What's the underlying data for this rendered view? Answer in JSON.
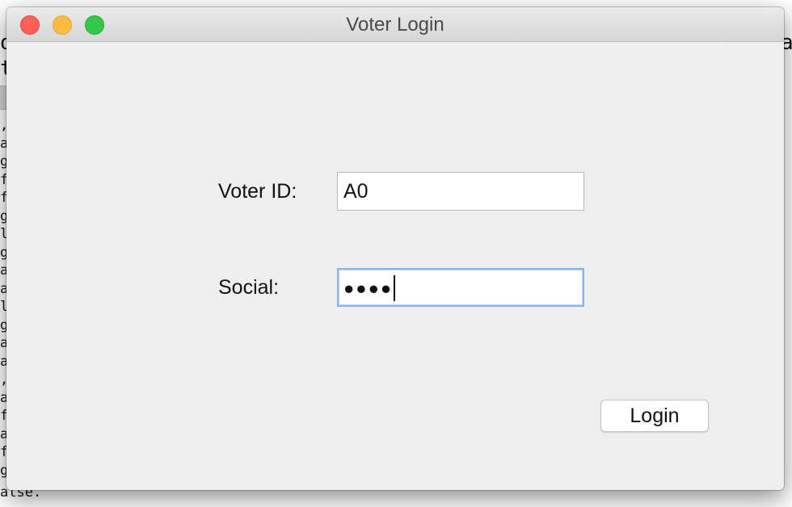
{
  "background": {
    "top_line_1": "o",
    "top_line_2": "t",
    "top_right_1": "a",
    "left_column": [
      ",",
      "a",
      "g",
      "f",
      "f",
      "g",
      "l",
      "g",
      "a",
      "a",
      "l",
      "g",
      "a",
      "a",
      ",",
      "a",
      "f",
      "a",
      "f",
      "g"
    ],
    "bottom_line": "alse."
  },
  "window": {
    "title": "Voter Login"
  },
  "form": {
    "voter_id_label": "Voter ID:",
    "voter_id_value": "A0",
    "social_label": "Social:",
    "social_masked_value": "●●●●"
  },
  "buttons": {
    "login_label": "Login"
  },
  "colors": {
    "window_bg": "#eeeeee",
    "focus_ring": "#86b5ea",
    "close": "#fc605b",
    "minimize": "#fdbc40",
    "maximize": "#34c84a"
  },
  "icons": [
    "close-icon",
    "minimize-icon",
    "maximize-icon"
  ]
}
